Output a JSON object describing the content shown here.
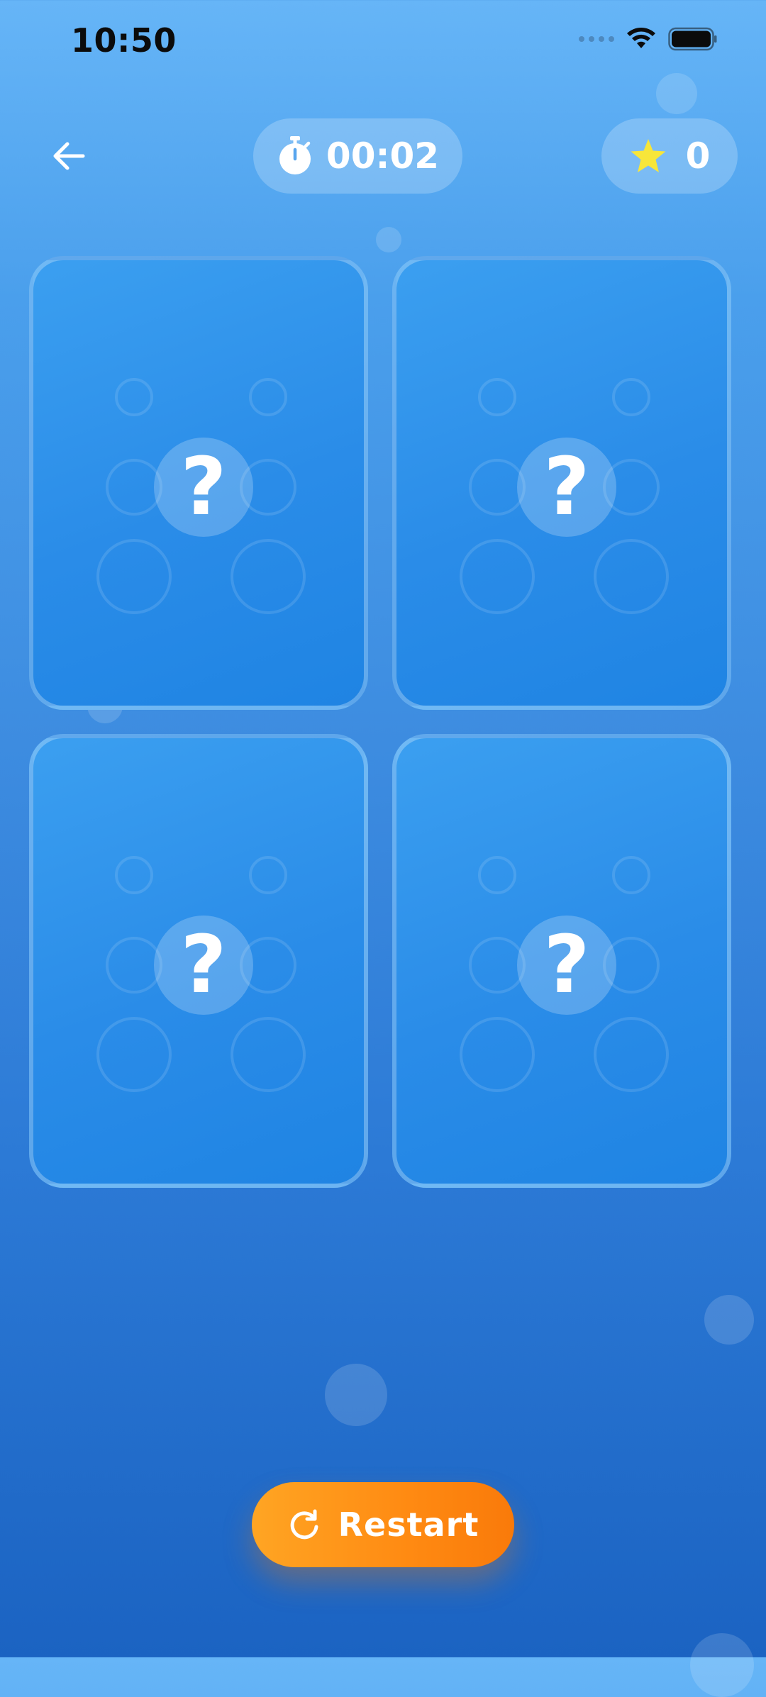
{
  "status_bar": {
    "time": "10:50"
  },
  "header": {
    "back_icon": "arrow-left-icon",
    "timer": {
      "icon": "stopwatch-icon",
      "value": "00:02"
    },
    "score": {
      "icon": "star-icon",
      "value": "0",
      "star_color": "#f7e63a"
    }
  },
  "cards": [
    {
      "mark": "?",
      "state": "face-down"
    },
    {
      "mark": "?",
      "state": "face-down"
    },
    {
      "mark": "?",
      "state": "face-down"
    },
    {
      "mark": "?",
      "state": "face-down"
    }
  ],
  "restart": {
    "icon": "refresh-icon",
    "label": "Restart",
    "color": "#ff8a12"
  }
}
